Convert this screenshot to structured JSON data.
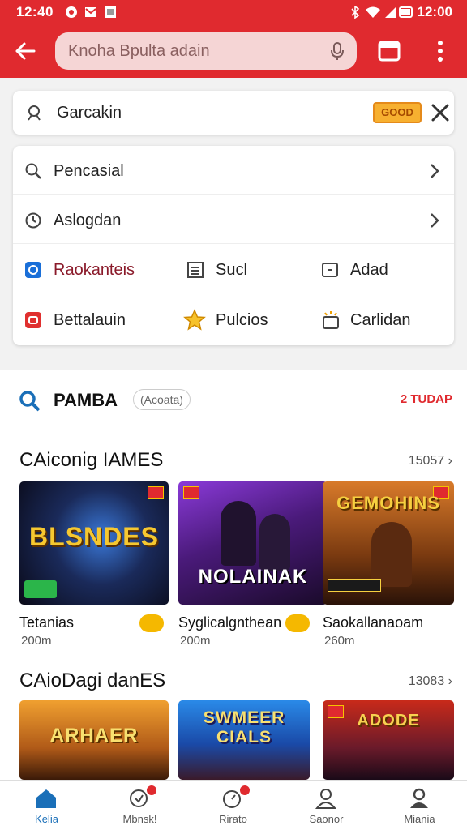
{
  "status_bar": {
    "time_left": "12:40",
    "time_right": "12:00"
  },
  "address_bar": {
    "text": "Knoha Bpulta adain"
  },
  "search": {
    "query": "Garcakin",
    "promo_label": "GOOD"
  },
  "suggestions": [
    {
      "label": "Pencasial",
      "icon": "search-icon"
    },
    {
      "label": "Aslogdan",
      "icon": "clock-icon"
    }
  ],
  "quick_links": [
    {
      "label": "Raokanteis",
      "icon": "blue-app-icon",
      "color": "#8a1a2a"
    },
    {
      "label": "Sucl",
      "icon": "list-icon",
      "color": "#222222"
    },
    {
      "label": "Adad",
      "icon": "add-box-icon",
      "color": "#222222"
    },
    {
      "label": "Bettalauin",
      "icon": "red-app-icon",
      "color": "#222222"
    },
    {
      "label": "Pulcios",
      "icon": "star-icon",
      "color": "#222222"
    },
    {
      "label": "Carlidan",
      "icon": "sparkle-box-icon",
      "color": "#222222"
    }
  ],
  "pamba": {
    "title": "PAMBA",
    "chip": "(Acoata)",
    "right_label": "2 TUDAP"
  },
  "section1": {
    "title": "CAiconig IAMES",
    "count": "15057 ›",
    "games": [
      {
        "art_title": "BLSNDES",
        "name": "Tetanias",
        "size": "200m"
      },
      {
        "art_title": "NOLAINAK",
        "name": "Syglicalgnthean",
        "size": "200m"
      },
      {
        "art_title": "GEMOHINS",
        "name": "Saokallanaoam",
        "size": "260m"
      }
    ]
  },
  "section2": {
    "title": "CAioDagi danES",
    "count": "13083 ›",
    "games": [
      {
        "art_title": "ARHAER"
      },
      {
        "art_title": "SWMEER CIALS"
      },
      {
        "art_title": "ADODE"
      }
    ]
  },
  "bottom_nav": [
    {
      "label": "Kelia",
      "icon": "home-icon",
      "active": true
    },
    {
      "label": "Mbnsk!",
      "icon": "games-icon",
      "active": false
    },
    {
      "label": "Rirato",
      "icon": "timer-icon",
      "active": false
    },
    {
      "label": "Saonor",
      "icon": "account-icon",
      "active": false
    },
    {
      "label": "Miania",
      "icon": "profile-icon",
      "active": false
    }
  ],
  "colors": {
    "accent": "#e02a2f",
    "active_nav": "#1a6fb8"
  }
}
